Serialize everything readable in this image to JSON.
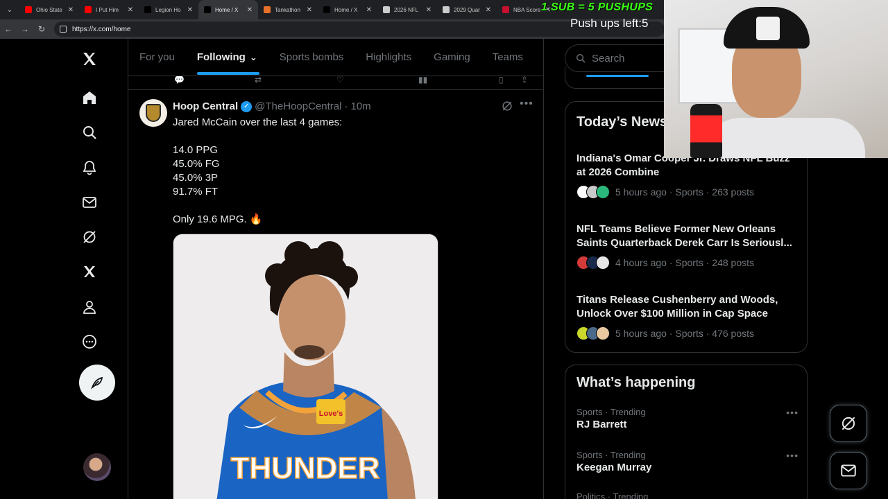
{
  "browser": {
    "tabs": [
      {
        "title": "Ohio State",
        "favicon_color": "#ff0000",
        "active": false
      },
      {
        "title": "I Put Him",
        "favicon_color": "#ff0000",
        "active": false
      },
      {
        "title": "Legion Ho",
        "favicon_color": "#000000",
        "active": false
      },
      {
        "title": "Home / X",
        "favicon_color": "#000000",
        "active": true
      },
      {
        "title": "Tankathon",
        "favicon_color": "#e8712a",
        "active": false
      },
      {
        "title": "Home / X",
        "favicon_color": "#000000",
        "active": false
      },
      {
        "title": "2026 NFL",
        "favicon_color": "#cccccc",
        "active": false
      },
      {
        "title": "2029 Quar",
        "favicon_color": "#cccccc",
        "active": false
      },
      {
        "title": "NBA Score",
        "favicon_color": "#c8102e",
        "active": false
      }
    ],
    "url": "https://x.com/home"
  },
  "overlay": {
    "banner": "1 SUB = 5 PUSHUPS",
    "counter": "Push ups left:5"
  },
  "feed_tabs": [
    {
      "label": "For you",
      "active": false
    },
    {
      "label": "Following",
      "active": true
    },
    {
      "label": "Sports bombs",
      "active": false
    },
    {
      "label": "Highlights",
      "active": false
    },
    {
      "label": "Gaming",
      "active": false
    },
    {
      "label": "Teams",
      "active": false
    }
  ],
  "tweet": {
    "name": "Hoop Central",
    "handle": "@TheHoopCentral",
    "dot": "·",
    "time": "10m",
    "lines": [
      "Jared McCain over the last 4 games:",
      "",
      "14.0 PPG",
      "45.0% FG",
      "45.0% 3P",
      "91.7% FT",
      "",
      "Only 19.6 MPG. 🔥"
    ],
    "jersey_text": "THUNDER",
    "jersey_patch": "Love's"
  },
  "sidebar": {
    "search_placeholder": "Search",
    "news_title": "Today’s News",
    "news": [
      {
        "headline": "Indiana's Omar Cooper Jr. Draws NFL Buzz at 2026 Combine",
        "meta": "5 hours ago · Sports · 263 posts",
        "face_colors": [
          "#ffffff",
          "#c9c9c9",
          "#2ab77a"
        ]
      },
      {
        "headline": "NFL Teams Believe Former New Orleans Saints Quarterback Derek Carr Is Seriousl...",
        "meta": "4 hours ago · Sports · 248 posts",
        "face_colors": [
          "#d33a3a",
          "#1a2a4a",
          "#e6e6e6"
        ]
      },
      {
        "headline": "Titans Release Cushenberry and Woods, Unlock Over $100 Million in Cap Space",
        "meta": "5 hours ago · Sports · 476 posts",
        "face_colors": [
          "#c9d82b",
          "#4a6a8a",
          "#e8c9a0"
        ]
      }
    ],
    "happening_title": "What’s happening",
    "trends": [
      {
        "category": "Sports · Trending",
        "name": "RJ Barrett"
      },
      {
        "category": "Sports · Trending",
        "name": "Keegan Murray"
      },
      {
        "category": "Politics · Trending",
        "name": ""
      }
    ]
  },
  "colors": {
    "accent": "#1d9bf0",
    "background": "#000000",
    "border": "#2f3336",
    "muted": "#71767b",
    "overlay_green": "#39ff14"
  },
  "icons": [
    "x-logo-icon",
    "home-icon",
    "explore-icon",
    "notifications-icon",
    "messages-icon",
    "grok-icon",
    "premium-icon",
    "profile-icon",
    "more-icon",
    "post-compose-icon"
  ]
}
